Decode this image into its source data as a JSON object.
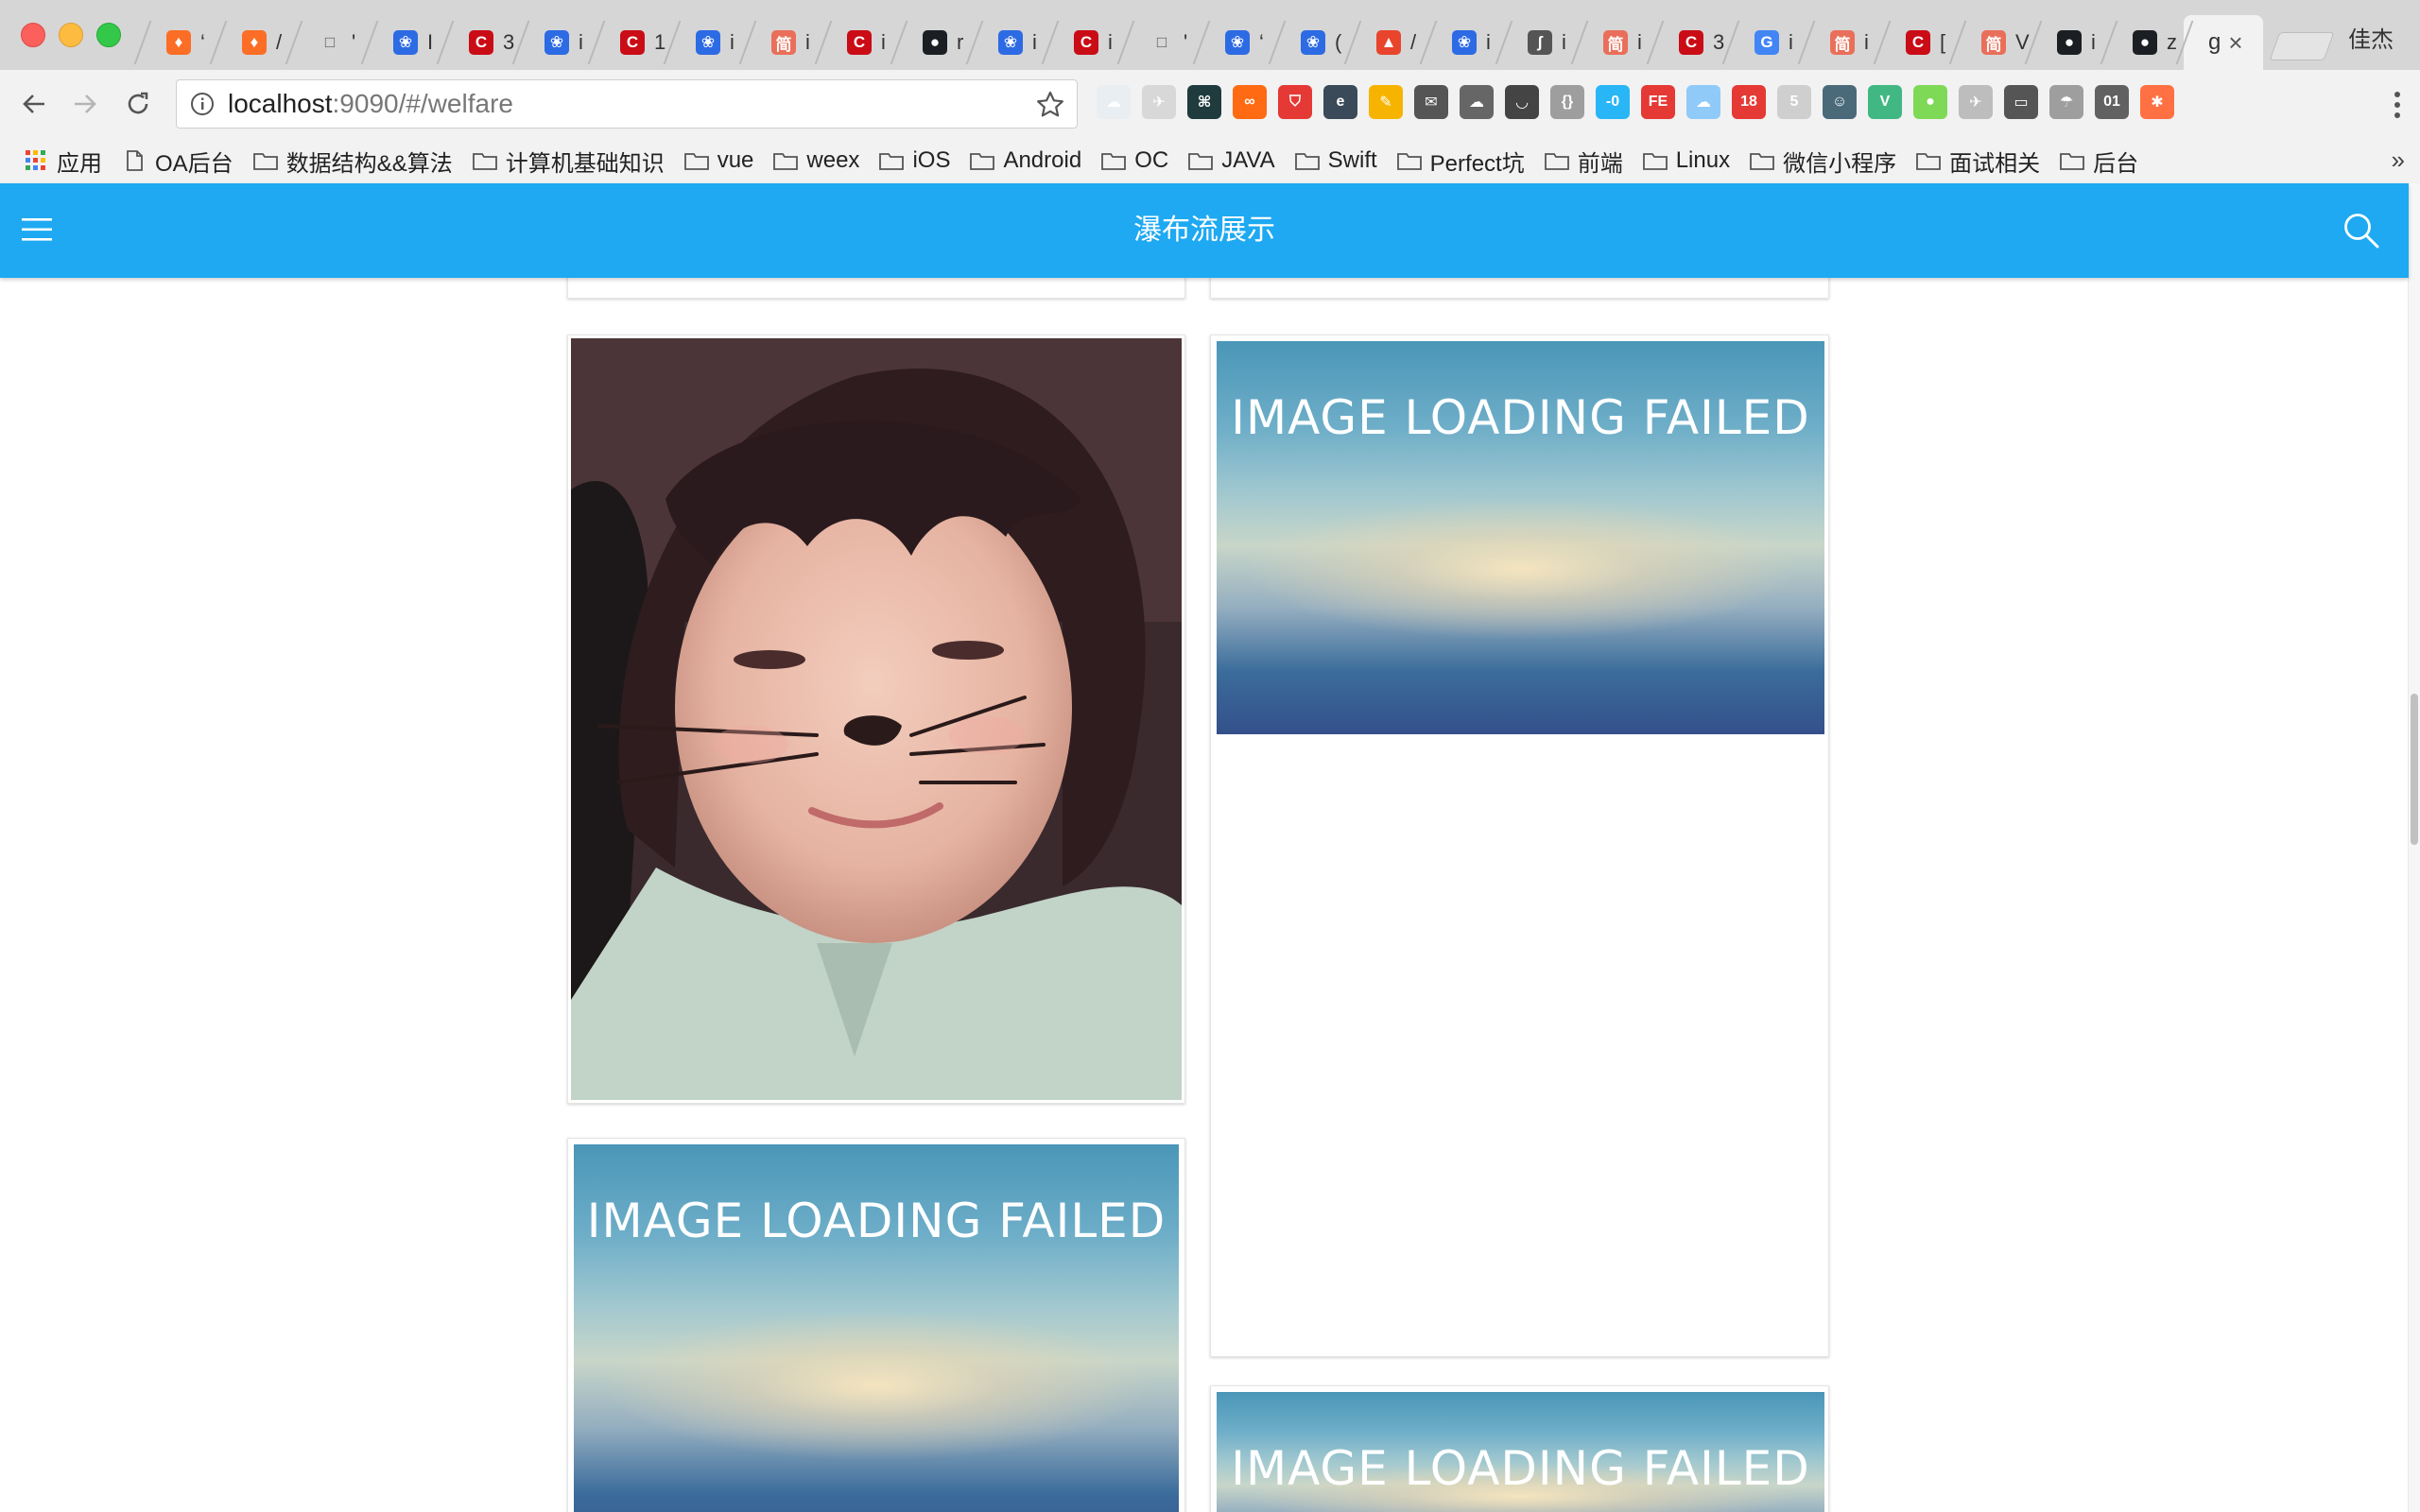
{
  "browser": {
    "tabs": [
      {
        "icon": "gitlab-icon",
        "color": "#fc6d26",
        "glyph": "♦",
        "text": "‘"
      },
      {
        "icon": "gitlab-icon",
        "color": "#fc6d26",
        "glyph": "♦",
        "text": "/"
      },
      {
        "icon": "document-icon",
        "color": "#ffffff",
        "glyph": "□",
        "text": "'"
      },
      {
        "icon": "baidu-icon",
        "color": "#2d6be4",
        "glyph": "❀",
        "text": "I"
      },
      {
        "icon": "csdn-icon",
        "color": "#ca0c16",
        "glyph": "C",
        "text": "3"
      },
      {
        "icon": "baidu-icon",
        "color": "#2d6be4",
        "glyph": "❀",
        "text": "i"
      },
      {
        "icon": "csdn-icon",
        "color": "#ca0c16",
        "glyph": "C",
        "text": "1"
      },
      {
        "icon": "baidu-icon",
        "color": "#2d6be4",
        "glyph": "❀",
        "text": "i"
      },
      {
        "icon": "jianshu-icon",
        "color": "#ea6f5a",
        "glyph": "简",
        "text": "i"
      },
      {
        "icon": "csdn-icon",
        "color": "#ca0c16",
        "glyph": "C",
        "text": "i"
      },
      {
        "icon": "github-icon",
        "color": "#1b1f23",
        "glyph": "●",
        "text": "r"
      },
      {
        "icon": "baidu-icon",
        "color": "#2d6be4",
        "glyph": "❀",
        "text": "i"
      },
      {
        "icon": "csdn-icon",
        "color": "#ca0c16",
        "glyph": "C",
        "text": "i"
      },
      {
        "icon": "document-icon",
        "color": "#ffffff",
        "glyph": "□",
        "text": "'"
      },
      {
        "icon": "baidu-icon",
        "color": "#2d6be4",
        "glyph": "❀",
        "text": "‘"
      },
      {
        "icon": "baidu-icon",
        "color": "#2d6be4",
        "glyph": "❀",
        "text": "("
      },
      {
        "icon": "flame-icon",
        "color": "#e8452c",
        "glyph": "▲",
        "text": "/"
      },
      {
        "icon": "baidu-icon",
        "color": "#2d6be4",
        "glyph": "❀",
        "text": "i"
      },
      {
        "icon": "script-icon",
        "color": "#555555",
        "glyph": "ʃ",
        "text": "i"
      },
      {
        "icon": "jianshu-icon",
        "color": "#ea6f5a",
        "glyph": "简",
        "text": "i"
      },
      {
        "icon": "csdn-icon",
        "color": "#ca0c16",
        "glyph": "C",
        "text": "3"
      },
      {
        "icon": "google-icon",
        "color": "#4285f4",
        "glyph": "G",
        "text": "i"
      },
      {
        "icon": "jianshu-icon",
        "color": "#ea6f5a",
        "glyph": "简",
        "text": "i"
      },
      {
        "icon": "csdn-icon",
        "color": "#ca0c16",
        "glyph": "C",
        "text": "["
      },
      {
        "icon": "jianshu-icon",
        "color": "#ea6f5a",
        "glyph": "简",
        "text": "V"
      },
      {
        "icon": "github-icon",
        "color": "#1b1f23",
        "glyph": "●",
        "text": "i"
      },
      {
        "icon": "github-icon",
        "color": "#1b1f23",
        "glyph": "●",
        "text": "z"
      }
    ],
    "active_tab": {
      "text": "g",
      "close": "×"
    },
    "profile_name": "佳杰",
    "url_host": "localhost",
    "url_path": ":9090/#/welfare",
    "extensions": [
      {
        "name": "cloud-icon",
        "color": "#e9eef2",
        "label": "☁"
      },
      {
        "name": "bird-icon",
        "color": "#d8d8d8",
        "label": "✈"
      },
      {
        "name": "terminal-icon",
        "color": "#1f3b3e",
        "label": "⌘"
      },
      {
        "name": "infinity-icon",
        "color": "#ff6a13",
        "label": "∞"
      },
      {
        "name": "shield-icon",
        "color": "#e53935",
        "label": "⛉"
      },
      {
        "name": "e-icon",
        "color": "#3a4a58",
        "label": "e"
      },
      {
        "name": "pen-icon",
        "color": "#f6b400",
        "label": "✎"
      },
      {
        "name": "mail-icon",
        "color": "#555555",
        "label": "✉"
      },
      {
        "name": "chat-icon",
        "color": "#666666",
        "label": "☁"
      },
      {
        "name": "pocket-icon",
        "color": "#444444",
        "label": "◡"
      },
      {
        "name": "json-icon",
        "color": "#9e9e9e",
        "label": "{}"
      },
      {
        "name": "code-icon",
        "color": "#29b6f6",
        "label": "-0"
      },
      {
        "name": "fe-icon",
        "color": "#e53935",
        "label": "FE"
      },
      {
        "name": "cloud-download-icon",
        "color": "#90caf9",
        "label": "☁"
      },
      {
        "name": "calendar-icon",
        "color": "#e53935",
        "label": "18"
      },
      {
        "name": "five-icon",
        "color": "#cfcfcf",
        "label": "5"
      },
      {
        "name": "avatar-icon",
        "color": "#4a6a7a",
        "label": "☺"
      },
      {
        "name": "vue-icon",
        "color": "#41b883",
        "label": "V"
      },
      {
        "name": "color-icon",
        "color": "#7ed957",
        "label": "●"
      },
      {
        "name": "plane-icon",
        "color": "#bdbdbd",
        "label": "✈"
      },
      {
        "name": "cast-icon",
        "color": "#555555",
        "label": "▭"
      },
      {
        "name": "parachute-icon",
        "color": "#9e9e9e",
        "label": "☂"
      },
      {
        "name": "binary-icon",
        "color": "#616161",
        "label": "01"
      },
      {
        "name": "orange-icon",
        "color": "#ff7043",
        "label": "✱"
      }
    ],
    "bookmarks": [
      {
        "label": "应用",
        "icon": "apps-grid-icon"
      },
      {
        "label": "OA后台",
        "icon": "document-icon"
      },
      {
        "label": "数据结构&&算法",
        "icon": "folder-icon"
      },
      {
        "label": "计算机基础知识",
        "icon": "folder-icon"
      },
      {
        "label": "vue",
        "icon": "folder-icon"
      },
      {
        "label": "weex",
        "icon": "folder-icon"
      },
      {
        "label": "iOS",
        "icon": "folder-icon"
      },
      {
        "label": "Android",
        "icon": "folder-icon"
      },
      {
        "label": "OC",
        "icon": "folder-icon"
      },
      {
        "label": "JAVA",
        "icon": "folder-icon"
      },
      {
        "label": "Swift",
        "icon": "folder-icon"
      },
      {
        "label": "Perfect坑",
        "icon": "folder-icon"
      },
      {
        "label": "前端",
        "icon": "folder-icon"
      },
      {
        "label": "Linux",
        "icon": "folder-icon"
      },
      {
        "label": "微信小程序",
        "icon": "folder-icon"
      },
      {
        "label": "面试相关",
        "icon": "folder-icon"
      },
      {
        "label": "后台",
        "icon": "folder-icon"
      }
    ],
    "bookmarks_more": "»"
  },
  "app": {
    "title": "瀑布流展示",
    "accent": "#1ea9f2",
    "failed_text": "IMAGE LOADING FAILED"
  }
}
